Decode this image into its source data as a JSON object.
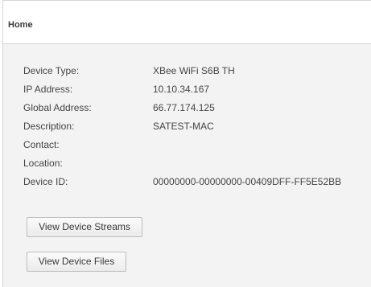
{
  "header": {
    "title": "Home"
  },
  "device": {
    "rows": [
      {
        "label": "Device Type:",
        "value": "XBee WiFi S6B TH"
      },
      {
        "label": "IP Address:",
        "value": "10.10.34.167"
      },
      {
        "label": "Global Address:",
        "value": "66.77.174.125"
      },
      {
        "label": "Description:",
        "value": "SATEST-MAC"
      },
      {
        "label": "Contact:",
        "value": ""
      },
      {
        "label": "Location:",
        "value": ""
      },
      {
        "label": "Device ID:",
        "value": "00000000-00000000-00409DFF-FF5E52BB"
      }
    ]
  },
  "actions": {
    "view_streams_label": "View Device Streams",
    "view_files_label": "View Device Files"
  }
}
